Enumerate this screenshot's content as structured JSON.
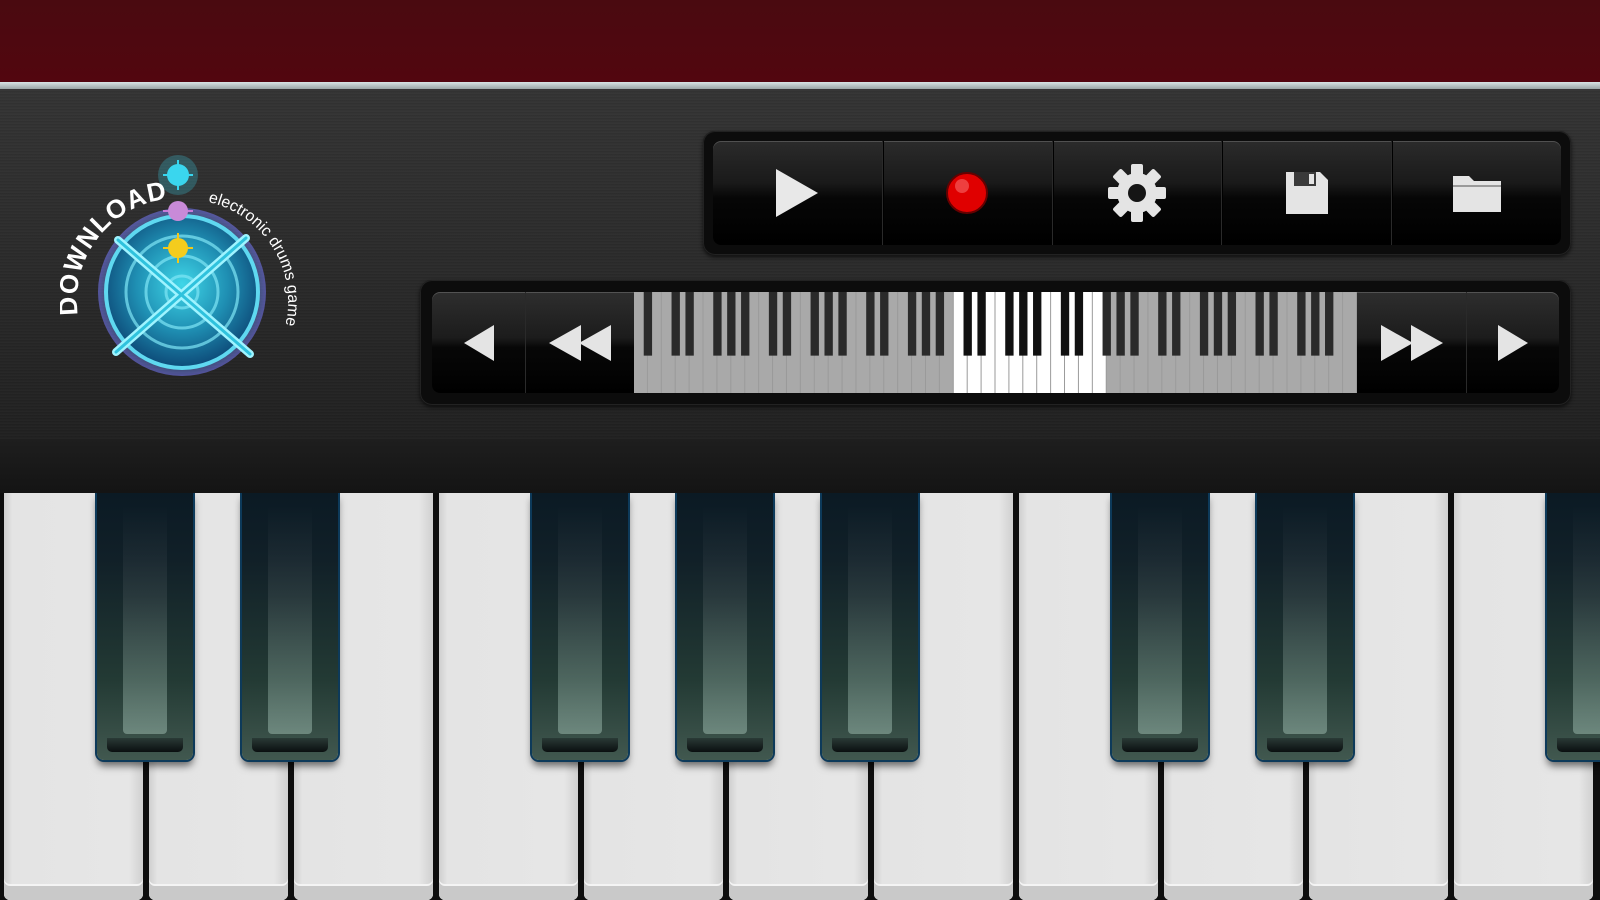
{
  "promo": {
    "headline": "DOWNLOAD",
    "tagline": "electronic drums game",
    "icon": "crossed-drumsticks-target-icon"
  },
  "transport": {
    "buttons": [
      {
        "name": "play",
        "icon": "play-icon"
      },
      {
        "name": "record",
        "icon": "record-icon"
      },
      {
        "name": "settings",
        "icon": "gear-icon"
      },
      {
        "name": "save",
        "icon": "floppy-disk-icon"
      },
      {
        "name": "open",
        "icon": "folder-icon"
      }
    ]
  },
  "navigator": {
    "buttons": [
      {
        "name": "step-left",
        "icon": "arrow-left-icon"
      },
      {
        "name": "fast-left",
        "icon": "double-arrow-left-icon"
      },
      {
        "name": "fast-right",
        "icon": "double-arrow-right-icon"
      },
      {
        "name": "step-right",
        "icon": "arrow-right-icon"
      }
    ],
    "visible_range_start": 0.44,
    "visible_range_end": 0.65
  },
  "keyboard": {
    "white_key_count": 11,
    "black_key_count": 8
  },
  "colors": {
    "banner": "#4d0812",
    "record": "#e00000",
    "glow": "#2fd5e8"
  }
}
